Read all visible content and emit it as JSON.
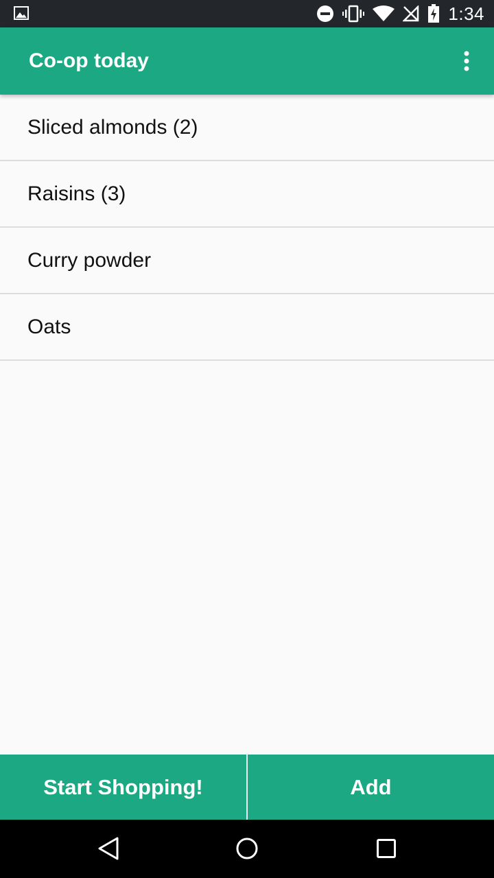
{
  "status_bar": {
    "time": "1:34",
    "icons": [
      "image-notification-icon",
      "do-not-disturb-icon",
      "vibrate-icon",
      "wifi-icon",
      "no-signal-icon",
      "battery-charging-icon"
    ]
  },
  "app_bar": {
    "title": "Co-op today",
    "menu_icon": "overflow-menu-icon"
  },
  "list": {
    "items": [
      {
        "label": "Sliced almonds (2)"
      },
      {
        "label": "Raisins (3)"
      },
      {
        "label": "Curry powder"
      },
      {
        "label": "Oats"
      }
    ]
  },
  "actions": {
    "start_label": "Start Shopping!",
    "add_label": "Add"
  },
  "nav_bar": {
    "icons": [
      "back-icon",
      "home-icon",
      "recents-icon"
    ]
  },
  "colors": {
    "accent": "#1ba882",
    "status_bar": "#23272b",
    "background": "#fafafa"
  }
}
